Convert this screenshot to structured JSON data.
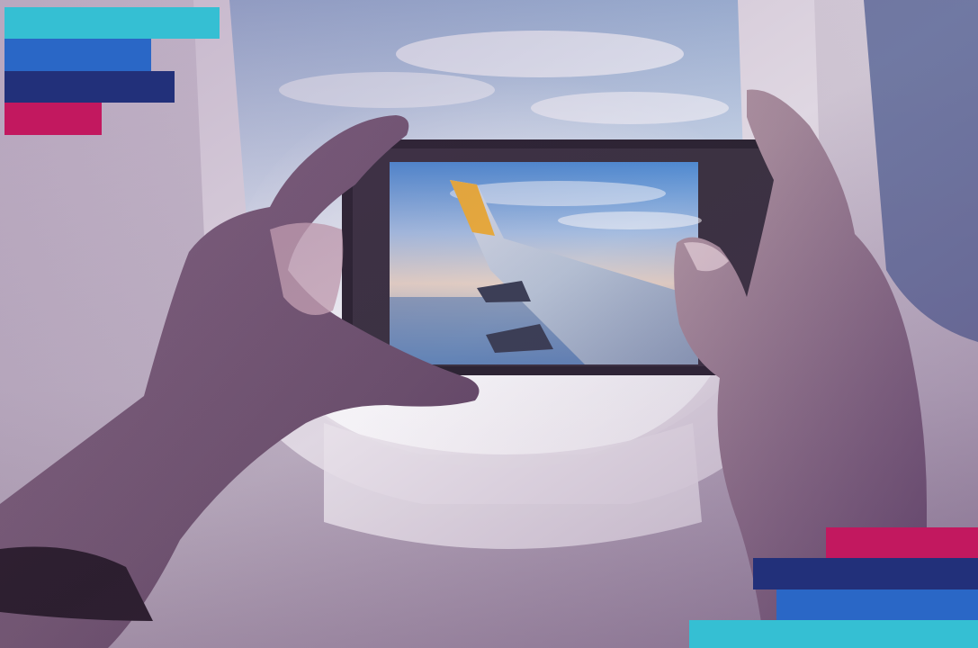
{
  "colors": {
    "cyan": "#35bfd3",
    "blue": "#2a67c6",
    "navy": "#22307a",
    "magenta": "#c2185f",
    "tint": "#5a2a6a"
  },
  "corner_bars": {
    "top_left": [
      "cyan",
      "blue",
      "navy",
      "magenta"
    ],
    "bottom_right": [
      "magenta",
      "navy",
      "blue",
      "cyan"
    ]
  }
}
